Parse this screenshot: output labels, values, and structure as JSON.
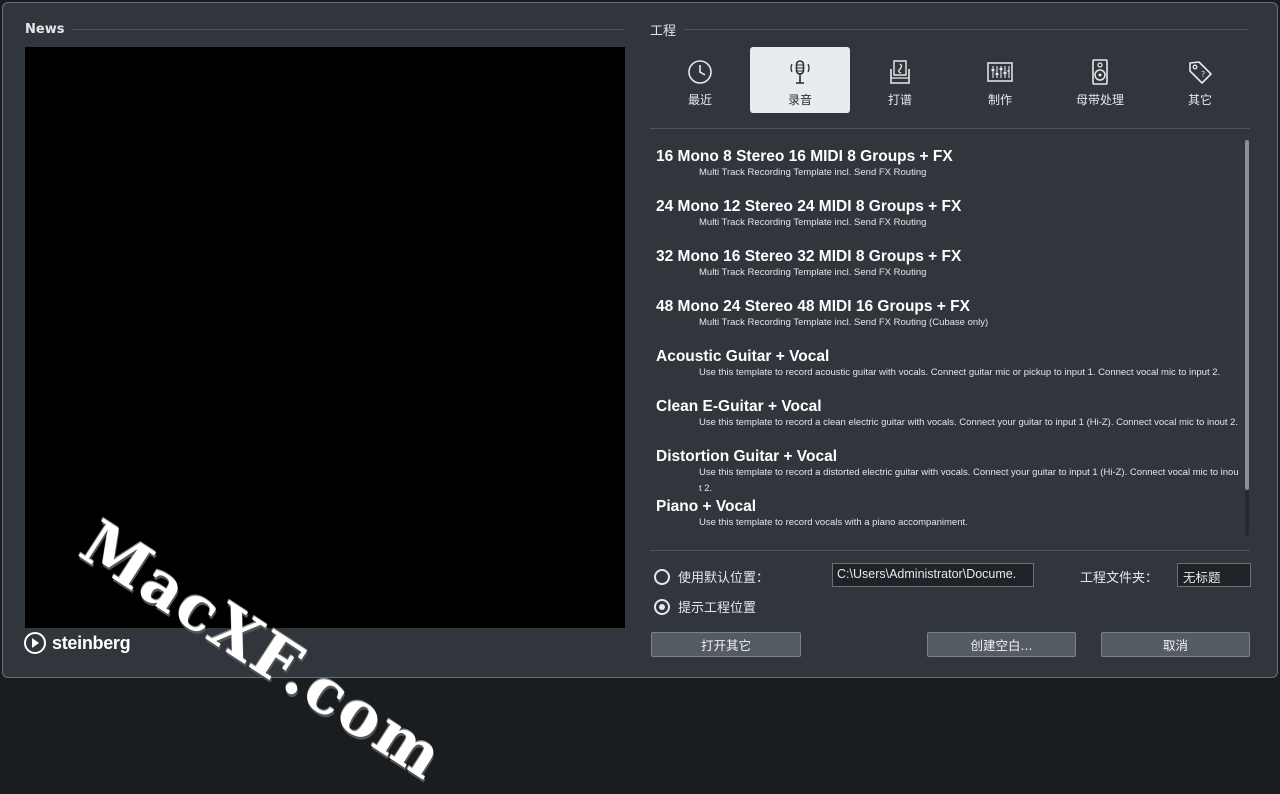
{
  "news": {
    "title": "News"
  },
  "watermark": "MacXF.com",
  "brand": {
    "name": "steinberg"
  },
  "project": {
    "title": "工程"
  },
  "tabs": [
    {
      "label": "最近",
      "icon": "clock-icon"
    },
    {
      "label": "录音",
      "icon": "microphone-icon",
      "active": true
    },
    {
      "label": "打谱",
      "icon": "score-icon"
    },
    {
      "label": "制作",
      "icon": "mixer-icon"
    },
    {
      "label": "母带处理",
      "icon": "speaker-icon"
    },
    {
      "label": "其它",
      "icon": "tag-icon"
    }
  ],
  "templates": [
    {
      "title": "16 Mono 8 Stereo 16 MIDI 8 Groups + FX",
      "description": "Multi Track Recording Template incl. Send FX Routing"
    },
    {
      "title": "24 Mono 12 Stereo 24 MIDI 8 Groups + FX",
      "description": "Multi Track Recording Template incl. Send FX Routing"
    },
    {
      "title": "32 Mono 16 Stereo 32 MIDI 8 Groups + FX",
      "description": "Multi Track Recording Template incl. Send FX Routing"
    },
    {
      "title": "48 Mono 24 Stereo 48 MIDI 16 Groups + FX",
      "description": "Multi Track Recording Template incl. Send FX Routing (Cubase only)"
    },
    {
      "title": "Acoustic Guitar + Vocal",
      "description": "Use this template to record acoustic guitar with vocals. Connect guitar mic or pickup to input  1. Connect vocal mic to input 2."
    },
    {
      "title": "Clean E-Guitar + Vocal",
      "description": "Use this template to record a clean electric guitar with vocals. Connect your guitar to input  1 (Hi-Z). Connect vocal mic to inout 2."
    },
    {
      "title": "Distortion Guitar + Vocal",
      "description": "Use this template to record a distorted electric guitar with vocals. Connect your guitar to input  1 (Hi-Z). Connect vocal mic to inout 2."
    },
    {
      "title": "Piano + Vocal",
      "description": "Use this template to record vocals with a piano accompaniment."
    }
  ],
  "location": {
    "default_label": "使用默认位置：",
    "default_checked": false,
    "prompt_label": "提示工程位置",
    "prompt_checked": true,
    "path_value": "C:\\Users\\Administrator\\Docume.",
    "folder_label": "工程文件夹：",
    "folder_value": "无标题"
  },
  "buttons": {
    "open_other": "打开其它",
    "create_empty": "创建空白...",
    "cancel": "取消"
  },
  "colors": {
    "window_bg": "#30363c",
    "active_tab_bg": "#e9ecef",
    "button_bg": "#555b62"
  }
}
